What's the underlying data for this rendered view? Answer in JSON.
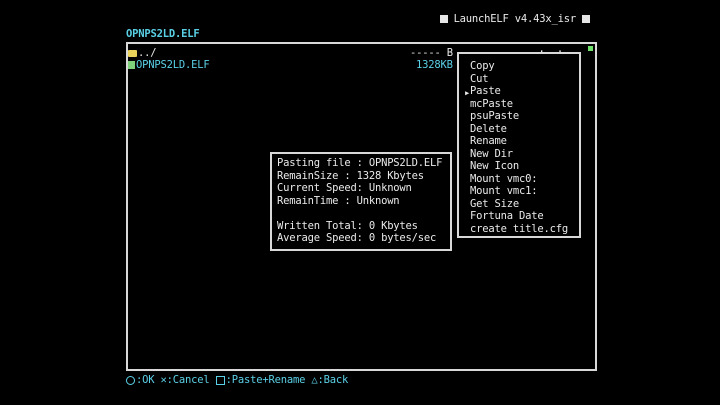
{
  "title": "LaunchELF v4.43x_isr",
  "current_path": "OPNPS2LD.ELF",
  "file_list": {
    "header_fragment": "----- B ---- -- -- --:--:--",
    "rows": [
      {
        "name": "../",
        "icon": "folder-icon"
      },
      {
        "name": "OPNPS2LD.ELF",
        "icon": "file-icon",
        "size": "1328KB"
      }
    ]
  },
  "context_menu": {
    "items": [
      "Copy",
      "Cut",
      "Paste",
      "mcPaste",
      "psuPaste",
      "Delete",
      "Rename",
      "New Dir",
      "New Icon",
      "Mount vmc0:",
      "Mount vmc1:",
      "Get Size",
      "Fortuna Date",
      "create title.cfg"
    ],
    "selected": "Paste",
    "cursor": "▸"
  },
  "paste_progress": {
    "lines": [
      "Pasting file : OPNPS2LD.ELF",
      "RemainSize : 1328 Kbytes",
      "Current Speed: Unknown",
      "RemainTime : Unknown",
      "",
      "Written Total: 0 Kbytes",
      "Average Speed: 0 bytes/sec"
    ]
  },
  "footer": {
    "ok": ":OK",
    "cancel": ":Cancel",
    "paste_rename": ":Paste+Rename",
    "back": ":Back"
  },
  "colors": {
    "accent": "#5ad0e6",
    "text": "#eaeaea",
    "folder": "#e8d25a",
    "status": "#6fe06a"
  }
}
